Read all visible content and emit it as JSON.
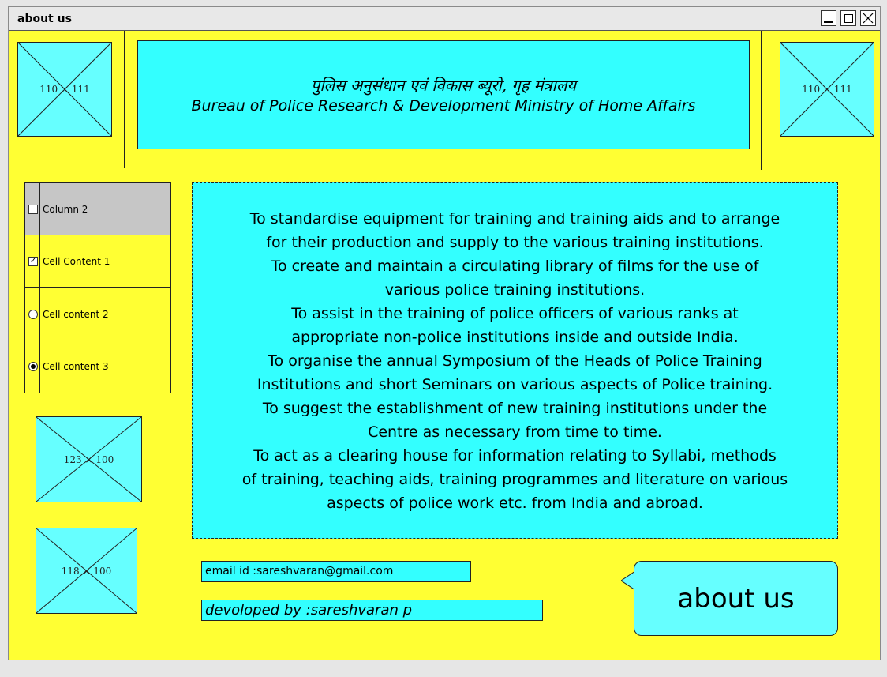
{
  "window": {
    "title": "about us"
  },
  "header": {
    "hindi_title": "पुलिस अनुसंधान एवं विकास ब्यूरो, गृह मंत्रालय",
    "english_title": "Bureau of Police Research & Development Ministry of Home Affairs"
  },
  "images": {
    "top_left": "110 × 111",
    "top_right": "110 × 111",
    "side_1": "123 × 100",
    "side_2": "118 × 100"
  },
  "grid": {
    "header": "Column 2",
    "rows": [
      {
        "label": "Cell Content 1",
        "control": "checkbox",
        "checked": true
      },
      {
        "label": "Cell content 2",
        "control": "radio",
        "checked": false
      },
      {
        "label": "Cell content 3",
        "control": "radio",
        "checked": true
      }
    ]
  },
  "content": {
    "lines": [
      "To standardise equipment for training and training aids and to arrange",
      "for their production and supply to the various training institutions.",
      "To create and maintain a circulating library of films for the use of",
      "various police training institutions.",
      "To assist in the training of police officers of various ranks at",
      "appropriate non-police institutions inside and outside India.",
      "To organise the annual Symposium of the Heads of Police Training",
      "Institutions and short Seminars on various aspects of Police training.",
      "To suggest the establishment of new training institutions under the",
      "Centre as necessary from time to time.",
      "To act as a clearing house for information relating to Syllabi, methods",
      "of training, teaching aids, training programmes and literature on various",
      "aspects of police work etc. from India and abroad."
    ]
  },
  "footer": {
    "email": "email id :sareshvaran@gmail.com",
    "developer": "devoloped by :sareshvaran p",
    "bubble": "about us"
  },
  "colors": {
    "background": "#ffff33",
    "panel": "#33ffff",
    "placeholder": "#66ffff"
  }
}
